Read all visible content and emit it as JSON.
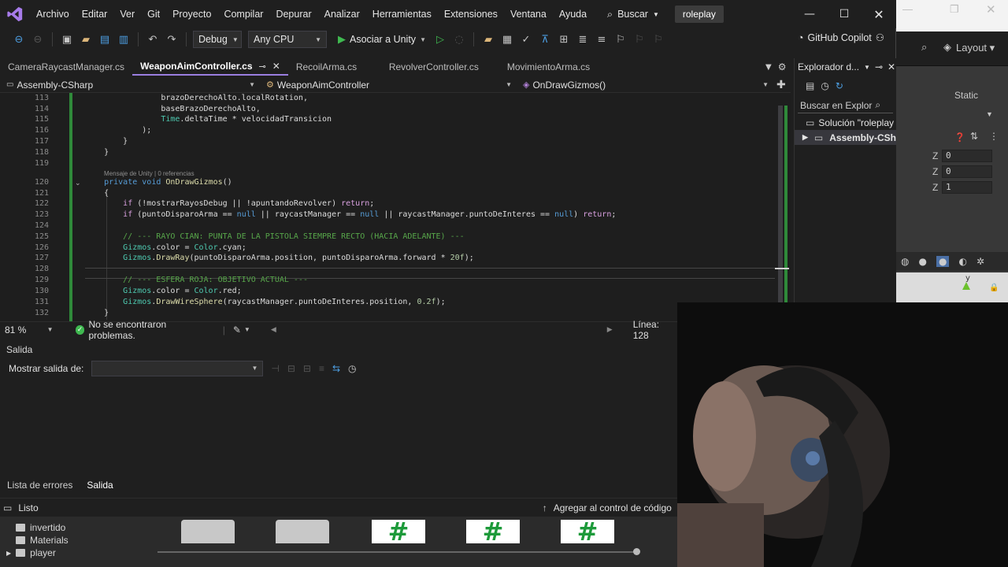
{
  "menubar": {
    "items": [
      "Archivo",
      "Editar",
      "Ver",
      "Git",
      "Proyecto",
      "Compilar",
      "Depurar",
      "Analizar",
      "Herramientas",
      "Extensiones",
      "Ventana",
      "Ayuda"
    ],
    "search_label": "Buscar",
    "solution_name": "roleplay"
  },
  "toolbar": {
    "config": "Debug",
    "platform": "Any CPU",
    "run_label": "Asociar a Unity",
    "copilot_label": "GitHub Copilot"
  },
  "tabs": [
    {
      "label": "CameraRaycastManager.cs",
      "active": false
    },
    {
      "label": "WeaponAimController.cs",
      "active": true
    },
    {
      "label": "RecoilArma.cs",
      "active": false
    },
    {
      "label": "RevolverController.cs",
      "active": false
    },
    {
      "label": "MovimientoArma.cs",
      "active": false
    }
  ],
  "navbar": {
    "project": "Assembly-CSharp",
    "class": "WeaponAimController",
    "member": "OnDrawGizmos()"
  },
  "code": {
    "lens_text": "Mensaje de Unity | 0 referencias",
    "lines": [
      {
        "n": "113",
        "text": "                brazoDerechoAlto.localRotation,"
      },
      {
        "n": "114",
        "text": "                baseBrazoDerechoAlto,"
      },
      {
        "n": "115",
        "text": "                Time.deltaTime * velocidadTransicion"
      },
      {
        "n": "116",
        "text": "            );"
      },
      {
        "n": "117",
        "text": "        }"
      },
      {
        "n": "118",
        "text": "    }"
      },
      {
        "n": "119",
        "text": ""
      },
      {
        "n": "120",
        "text": "    private void OnDrawGizmos()"
      },
      {
        "n": "121",
        "text": "    {"
      },
      {
        "n": "122",
        "text": "        if (!mostrarRayosDebug || !apuntandoRevolver) return;"
      },
      {
        "n": "123",
        "text": "        if (puntoDisparoArma == null || raycastManager == null || raycastManager.puntoDeInteres == null) return;"
      },
      {
        "n": "124",
        "text": ""
      },
      {
        "n": "125",
        "text": "        // --- RAYO CIAN: PUNTA DE LA PISTOLA SIEMPRE RECTO (HACIA ADELANTE) ---"
      },
      {
        "n": "126",
        "text": "        Gizmos.color = Color.cyan;"
      },
      {
        "n": "127",
        "text": "        Gizmos.DrawRay(puntoDisparoArma.position, puntoDisparoArma.forward * 20f);"
      },
      {
        "n": "128",
        "text": ""
      },
      {
        "n": "129",
        "text": "        // --- ESFERA ROJA: OBJETIVO ACTUAL ---"
      },
      {
        "n": "130",
        "text": "        Gizmos.color = Color.red;"
      },
      {
        "n": "131",
        "text": "        Gizmos.DrawWireSphere(raycastManager.puntoDeInteres.position, 0.2f);"
      },
      {
        "n": "132",
        "text": "    }"
      }
    ]
  },
  "editor_status": {
    "zoom": "81 %",
    "problems": "No se encontraron problemas.",
    "line": "Línea: 128"
  },
  "solution_explorer": {
    "title": "Explorador d...",
    "search": "Buscar en Explor",
    "solution": "Solución \"roleplay",
    "project": "Assembly-CSh"
  },
  "output": {
    "title": "Salida",
    "show_output_label": "Mostrar salida de:",
    "source_value": ""
  },
  "bottom_tabs": [
    "Lista de errores",
    "Salida"
  ],
  "status": {
    "ready": "Listo",
    "source_control": "Agregar al control de código"
  },
  "unity": {
    "layout_label": "Layout",
    "static_label": "Static",
    "z_labels": [
      "Z",
      "Z",
      "Z"
    ],
    "z_values": [
      "0",
      "0",
      "1"
    ],
    "gizmo_axis": "y",
    "project_folders": [
      "invertido",
      "Materials",
      "player"
    ]
  },
  "colors": {
    "accent": "#9a7ee0",
    "change_bar": "#2f8a3a",
    "ok": "#3fb950"
  }
}
